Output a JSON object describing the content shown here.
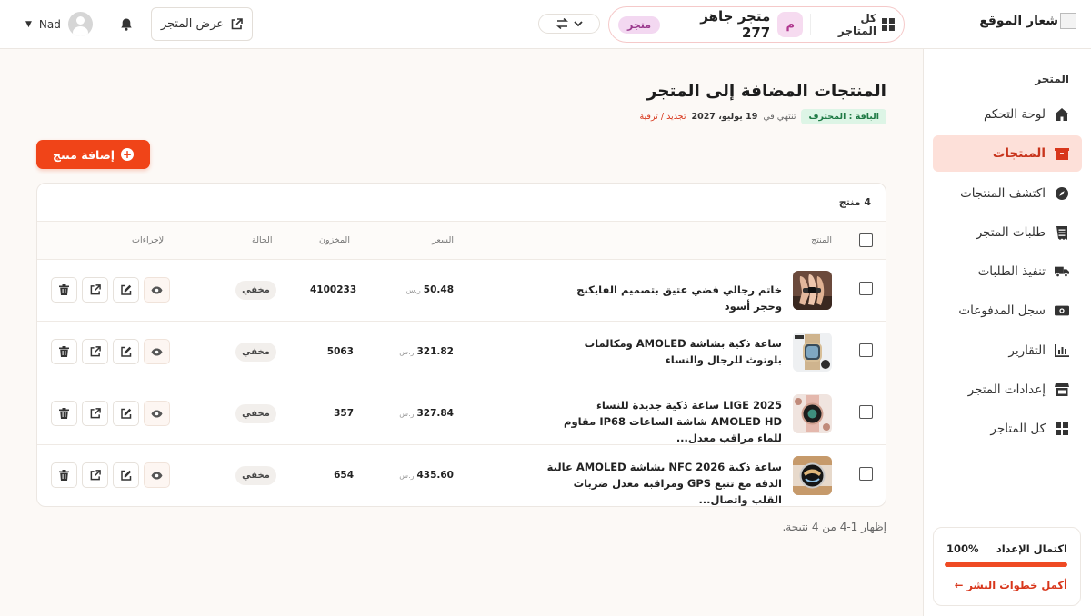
{
  "header": {
    "logo_text": "شعار الموقع",
    "all_stores_label": "كل المتاجر",
    "store_initial": "م",
    "store_name": "متجر جاهز 277",
    "store_badge": "متجر",
    "view_store_label": "عرض المتجر",
    "user_name": "Nad"
  },
  "sidebar": {
    "section_title": "المتجر",
    "items": [
      {
        "label": "لوحة التحكم",
        "icon": "home-icon",
        "active": false
      },
      {
        "label": "المنتجات",
        "icon": "box-icon",
        "active": true
      },
      {
        "label": "اكتشف المنتجات",
        "icon": "compass-icon",
        "active": false
      },
      {
        "label": "طلبات المتجر",
        "icon": "receipt-icon",
        "active": false
      },
      {
        "label": "تنفيذ الطلبات",
        "icon": "truck-icon",
        "active": false
      },
      {
        "label": "سجل المدفوعات",
        "icon": "money-icon",
        "active": false
      },
      {
        "label": "التقارير",
        "icon": "chart-icon",
        "active": false
      },
      {
        "label": "إعدادات المتجر",
        "icon": "store-icon",
        "active": false
      },
      {
        "label": "كل المتاجر",
        "icon": "grid-icon",
        "active": false
      }
    ],
    "setup": {
      "title": "اكتمال الإعداد",
      "percent_label": "100%",
      "progress": 1.0,
      "link": "أكمل خطوات النشر ←"
    }
  },
  "main": {
    "title": "المنتجات المضافة إلى المتجر",
    "plan_badge": "الباقة : المحترف",
    "expires_prefix": "تنتهي في",
    "expires_date": "19 يوليو، 2027",
    "renew_link": "تجديد / ترقية",
    "add_button": "إضافة منتج",
    "count_label": "4 منتج",
    "columns": {
      "product": "المنتج",
      "price": "السعر",
      "stock": "المخزون",
      "status": "الحالة",
      "actions": "الإجراءات"
    },
    "currency": "ر.س",
    "products": [
      {
        "name": "خاتم رجالي فضي عتيق بتصميم الفايكنج وحجر أسود",
        "price": "50.48",
        "stock": "4100233",
        "status": "مخفي",
        "thumb": "ring"
      },
      {
        "name": "ساعة ذكية بشاشة AMOLED ومكالمات بلوتوث للرجال والنساء",
        "price": "321.82",
        "stock": "5063",
        "status": "مخفي",
        "thumb": "watch-gold"
      },
      {
        "name": "LIGE 2025 ساعة ذكية جديدة للنساء AMOLED HD شاشة الساعات IP68 مقاوم للماء مراقب معدل...",
        "price": "327.84",
        "stock": "357",
        "status": "مخفي",
        "thumb": "watch-pink"
      },
      {
        "name": "ساعة ذكية NFC 2026 بشاشة AMOLED عالية الدقة مع تتبع GPS ومراقبة معدل ضربات القلب واتصال...",
        "price": "435.60",
        "stock": "654",
        "status": "مخفي",
        "thumb": "watch-silver"
      }
    ],
    "footer": "إظهار 1-4 من 4 نتيجة."
  },
  "colors": {
    "accent": "#f04418",
    "active_bg": "#fde0d9",
    "plan_badge_bg": "#ddf5e6"
  }
}
